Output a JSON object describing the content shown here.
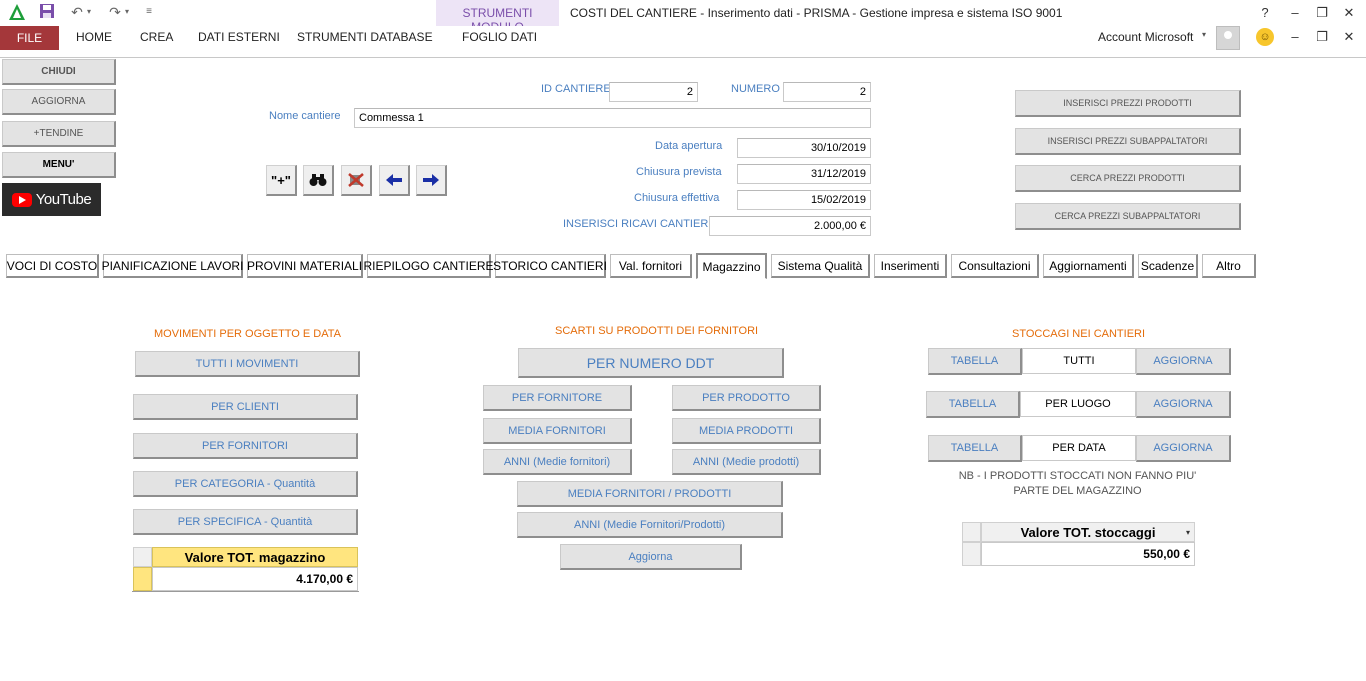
{
  "titlebar": {
    "title": "COSTI DEL CANTIERE - Inserimento dati - PRISMA - Gestione impresa e sistema ISO 9001",
    "contextual_group": "STRUMENTI MODULO",
    "help": "?",
    "account": "Account Microsoft"
  },
  "ribbon": {
    "tabs": [
      "FILE",
      "HOME",
      "CREA",
      "DATI ESTERNI",
      "STRUMENTI DATABASE",
      "FOGLIO DATI"
    ]
  },
  "left_buttons": [
    "CHIUDI",
    "AGGIORNA",
    "+TENDINE",
    "MENU'"
  ],
  "youtube_label": "YouTube",
  "header": {
    "id_cantiere_label": "ID CANTIERE",
    "id_cantiere": "2",
    "numero_label": "NUMERO",
    "numero": "2",
    "nome_label": "Nome cantiere",
    "nome": "Commessa 1",
    "data_apertura_label": "Data apertura",
    "data_apertura": "30/10/2019",
    "chiusura_prevista_label": "Chiusura prevista",
    "chiusura_prevista": "31/12/2019",
    "chiusura_effettiva_label": "Chiusura effettiva",
    "chiusura_effettiva": "15/02/2019",
    "ricavi_label": "INSERISCI RICAVI CANTIERE",
    "ricavi": "2.000,00 €"
  },
  "nav_buttons": {
    "new": "\"+\""
  },
  "right_buttons": [
    "INSERISCI PREZZI PRODOTTI",
    "INSERISCI PREZZI SUBAPPALTATORI",
    "CERCA PREZZI PRODOTTI",
    "CERCA PREZZI SUBAPPALTATORI"
  ],
  "tabs": [
    "VOCI DI COSTO",
    "PIANIFICAZIONE LAVORI",
    "PROVINI MATERIALI",
    "RIEPILOGO CANTIERE",
    "STORICO CANTIERI",
    "Val. fornitori",
    "Magazzino",
    "Sistema Qualità",
    "Inserimenti",
    "Consultazioni",
    "Aggiornamenti",
    "Scadenze",
    "Altro"
  ],
  "movimenti": {
    "title": "MOVIMENTI PER OGGETTO E DATA",
    "buttons": [
      "TUTTI I MOVIMENTI",
      "PER CLIENTI",
      "PER FORNITORI",
      "PER CATEGORIA - Quantità",
      "PER SPECIFICA - Quantità"
    ],
    "total_label": "Valore TOT. magazzino",
    "total_value": "4.170,00 €"
  },
  "scarti": {
    "title": "SCARTI SU PRODOTTI DEI FORNITORI",
    "main_button": "PER NUMERO DDT",
    "left_buttons": [
      "PER FORNITORE",
      "MEDIA FORNITORI",
      "ANNI (Medie fornitori)"
    ],
    "right_buttons": [
      "PER PRODOTTO",
      "MEDIA PRODOTTI",
      "ANNI (Medie prodotti)"
    ],
    "wide_buttons": [
      "MEDIA FORNITORI / PRODOTTI",
      "ANNI (Medie Fornitori/Prodotti)"
    ],
    "refresh": "Aggiorna"
  },
  "stoccaggi": {
    "title": "STOCCAGI NEI CANTIERI",
    "rows": [
      {
        "left": "TABELLA",
        "mid": "TUTTI",
        "right": "AGGIORNA"
      },
      {
        "left": "TABELLA",
        "mid": "PER LUOGO",
        "right": "AGGIORNA"
      },
      {
        "left": "TABELLA",
        "mid": "PER DATA",
        "right": "AGGIORNA"
      }
    ],
    "note_line1": "NB - I PRODOTTI STOCCATI NON FANNO PIU'",
    "note_line2": "PARTE DEL MAGAZZINO",
    "total_label": "Valore TOT. stoccaggi",
    "total_value": "550,00 €"
  },
  "colors": {
    "file_tab": "#a4373a",
    "contextual": "#ede4f6",
    "label_blue": "#4a7fc0",
    "section_orange": "#e46c0a",
    "header_yellow": "#ffe57f"
  }
}
